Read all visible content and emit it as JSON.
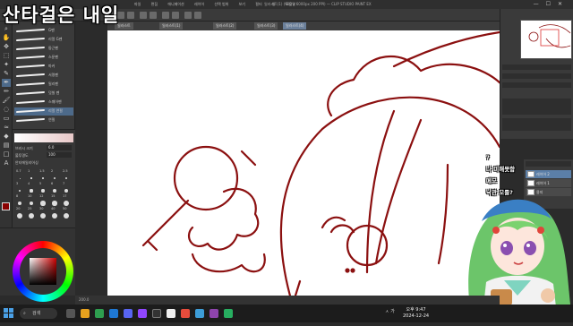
{
  "stream_title": "산타걸은 내일",
  "app": {
    "window_title": "일러스트(1) (900 x 6000px 200 PPI) — CLIP STUDIO PAINT EX",
    "menu": [
      "파일",
      "편집",
      "애니메이션",
      "레이어",
      "선택 범위",
      "보기",
      "필터",
      "창",
      "도움말"
    ],
    "canvas_tabs": [
      "일러스트",
      "일러스트(1)",
      "일러스트(2)",
      "일러스트(3)",
      "일러스트(4)"
    ],
    "active_tab_index": 4
  },
  "tools": [
    "돋보기",
    "손바닥",
    "이동",
    "선택",
    "자동선택",
    "스포이트",
    "펜",
    "연필",
    "붓",
    "에어브러시",
    "지우개",
    "색혼합",
    "채우기",
    "그라데이션",
    "도형",
    "텍스트"
  ],
  "subtools": [
    {
      "name": "G펜"
    },
    {
      "name": "리얼 G펜"
    },
    {
      "name": "둥근펜"
    },
    {
      "name": "스푼펜"
    },
    {
      "name": "마커"
    },
    {
      "name": "서명펜"
    },
    {
      "name": "밀리펜"
    },
    {
      "name": "덧칠 펜"
    },
    {
      "name": "스퀘어펜"
    },
    {
      "name": "리얼 연필"
    },
    {
      "name": "연필"
    }
  ],
  "selected_subtool_index": 9,
  "tool_properties": [
    {
      "label": "브러시 크기",
      "value": "6.0"
    },
    {
      "label": "불투명도",
      "value": "100"
    },
    {
      "label": "안티에일리어싱",
      "value": ""
    }
  ],
  "brush_sizes": [
    "0.7",
    "1",
    "1.5",
    "2",
    "2.5",
    "3",
    "4",
    "5",
    "6",
    "7",
    "8",
    "10",
    "12",
    "15",
    "17",
    "20",
    "25",
    "30",
    "40",
    "50"
  ],
  "colors": {
    "main": "#8b0000",
    "line": "#8b1010"
  },
  "layers": [
    {
      "name": "레이어 2"
    },
    {
      "name": "레이어 1"
    },
    {
      "name": "용지"
    }
  ],
  "selected_layer_index": 0,
  "chat": [
    "?",
    "나 미해못함",
    "메모",
    "낙관 모를?"
  ],
  "statusbar": {
    "zoom": "200.0"
  },
  "taskbar": {
    "search_placeholder": "검색",
    "clock_time": "오후 9:47",
    "clock_date": "2024-12-24",
    "tray": "ㅅ 가"
  }
}
